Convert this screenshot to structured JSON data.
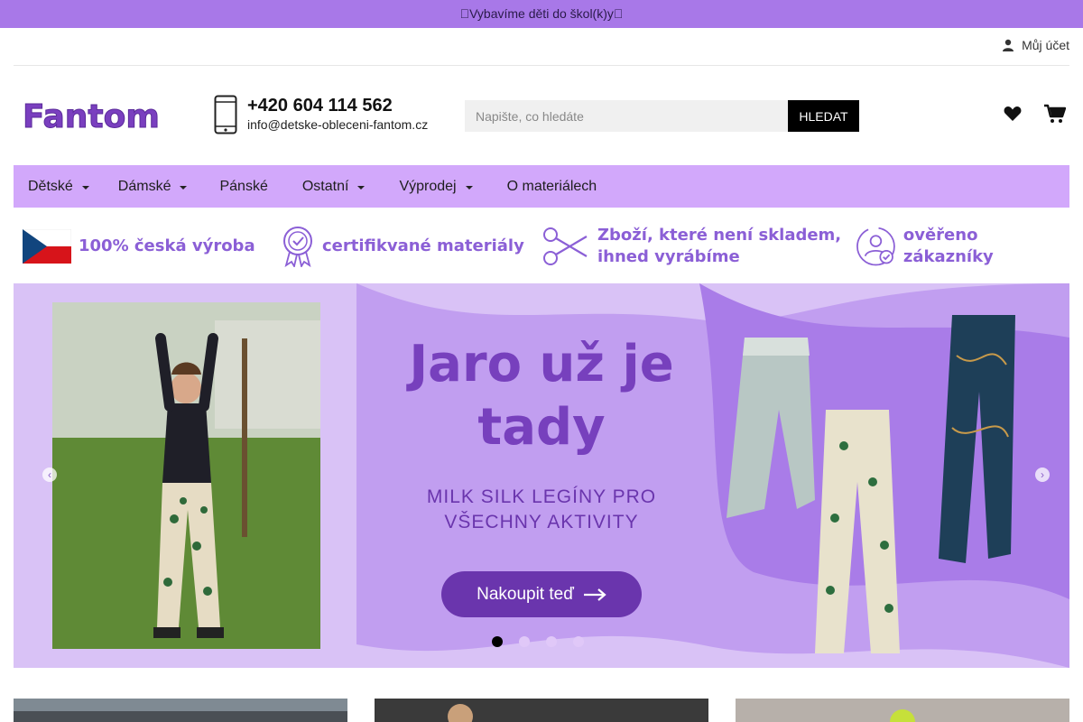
{
  "promo": {
    "text": "\u0000Vybavíme děti do škol(k)y\u0000"
  },
  "account": {
    "label": "Můj účet"
  },
  "brand": {
    "logo_text": "Fantom",
    "color": "#7a3fbf"
  },
  "contact": {
    "phone": "+420 604 114 562",
    "email": "info@detske-obleceni-fantom.cz"
  },
  "search": {
    "placeholder": "Napište, co hledáte",
    "button": "HLEDAT"
  },
  "nav": {
    "items": [
      {
        "label": "Dětské",
        "dropdown": true
      },
      {
        "label": "Dámské",
        "dropdown": true
      },
      {
        "label": "Pánské",
        "dropdown": false
      },
      {
        "label": "Ostatní",
        "dropdown": true
      },
      {
        "label": "Výprodej",
        "dropdown": true
      },
      {
        "label": "O materiálech",
        "dropdown": false
      }
    ]
  },
  "features": {
    "czech": "100% česká výroba",
    "certified": "certifikvané materiály",
    "made_line1": "Zboží, které není skladem,",
    "made_line2": "ihned vyrábíme",
    "verified": "ověřeno zákazníky"
  },
  "banner": {
    "title_line1": "Jaro už je",
    "title_line2": "tady",
    "sub_line1": "MILK SILK LEGÍNY PRO",
    "sub_line2": "VŠECHNY AKTIVITY",
    "cta": "Nakoupit teď",
    "prev": "‹",
    "next": "›",
    "slides": 4,
    "active_slide": 1
  },
  "colors": {
    "topbar": "#a878e8",
    "nav": "#d2a8fb",
    "accent": "#7740bd"
  }
}
